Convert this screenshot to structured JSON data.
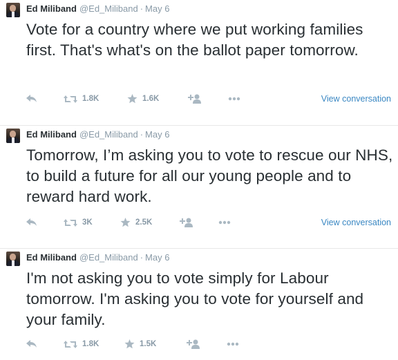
{
  "tweets": [
    {
      "name": "Ed Miliband",
      "handle": "@Ed_Miliband",
      "separator": "·",
      "date": "May 6",
      "text": "Vote for a country where we put working families first. That's what's on the ballot paper tomorrow.",
      "retweets": "1.8K",
      "favorites": "1.6K",
      "view_conversation": "View conversation"
    },
    {
      "name": "Ed Miliband",
      "handle": "@Ed_Miliband",
      "separator": "·",
      "date": "May 6",
      "text": "Tomorrow, I’m asking you to vote to rescue our NHS, to build a future for all our young people and to reward hard work.",
      "retweets": "3K",
      "favorites": "2.5K",
      "view_conversation": "View conversation"
    },
    {
      "name": "Ed Miliband",
      "handle": "@Ed_Miliband",
      "separator": "·",
      "date": "May 6",
      "text": "I'm not asking you to vote simply for Labour tomorrow. I'm asking you to vote for yourself and your family.",
      "retweets": "1.8K",
      "favorites": "1.5K",
      "view_conversation": ""
    }
  ],
  "icons": {
    "reply": "reply-icon",
    "retweet": "retweet-icon",
    "favorite": "star-icon",
    "follow": "follow-icon",
    "more": "more-icon"
  },
  "colors": {
    "name": "#292f33",
    "meta": "#8899a6",
    "icon": "#aab8c2",
    "link": "#3b88c3"
  }
}
